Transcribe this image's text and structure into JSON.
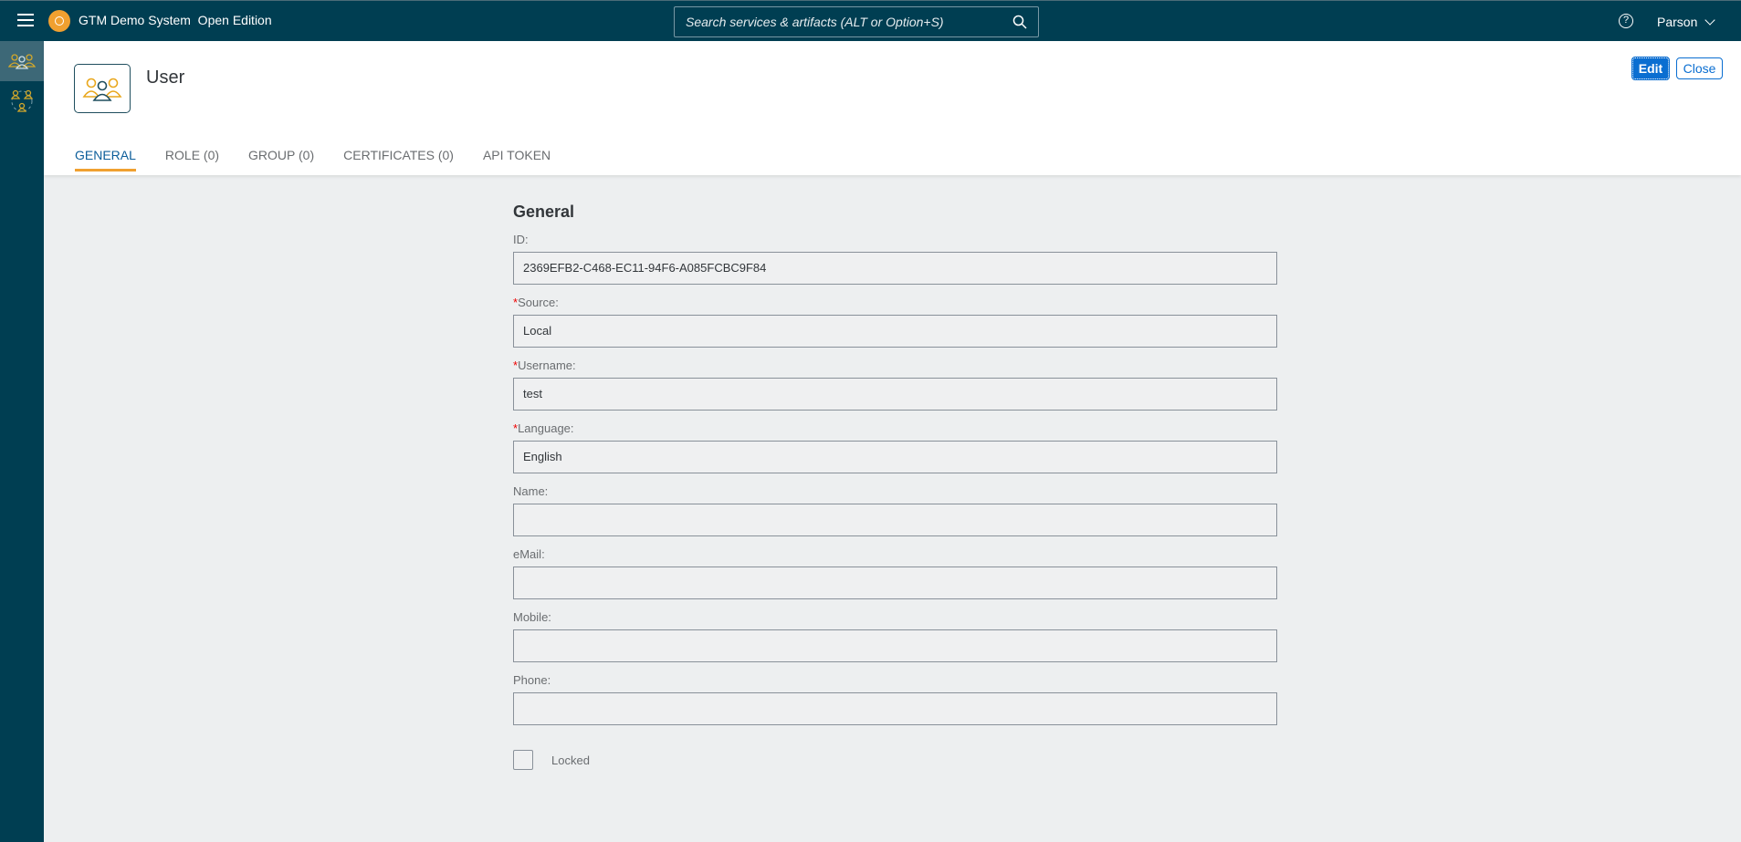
{
  "shell": {
    "title": "GTM Demo System  Open Edition",
    "search_placeholder": "Search services & artifacts (ALT or Option+S)",
    "help_label": "?",
    "user_name": "Parson"
  },
  "sidenav": {
    "items": [
      {
        "icon": "users-icon",
        "active": true
      },
      {
        "icon": "group-icon",
        "active": false
      }
    ]
  },
  "header": {
    "object_title": "User",
    "edit_label": "Edit",
    "close_label": "Close"
  },
  "tabs": [
    {
      "label": "GENERAL",
      "active": true
    },
    {
      "label": "ROLE (0)"
    },
    {
      "label": "GROUP (0)"
    },
    {
      "label": "CERTIFICATES (0)"
    },
    {
      "label": "API TOKEN"
    }
  ],
  "form": {
    "section_title": "General",
    "fields": [
      {
        "label": "ID:",
        "required": false,
        "value": "2369EFB2-C468-EC11-94F6-A085FCBC9F84"
      },
      {
        "label": "Source:",
        "required": true,
        "value": "Local"
      },
      {
        "label": "Username:",
        "required": true,
        "value": "test"
      },
      {
        "label": "Language:",
        "required": true,
        "value": "English"
      },
      {
        "label": "Name:",
        "required": false,
        "value": ""
      },
      {
        "label": "eMail:",
        "required": false,
        "value": ""
      },
      {
        "label": "Mobile:",
        "required": false,
        "value": ""
      },
      {
        "label": "Phone:",
        "required": false,
        "value": ""
      }
    ],
    "required_marker": "*",
    "locked_label": "Locked",
    "locked_checked": false
  },
  "colors": {
    "shell_bg": "#003e52",
    "accent": "#0a6ed1",
    "tab_indicator": "#f0a030",
    "required": "#e00000"
  }
}
